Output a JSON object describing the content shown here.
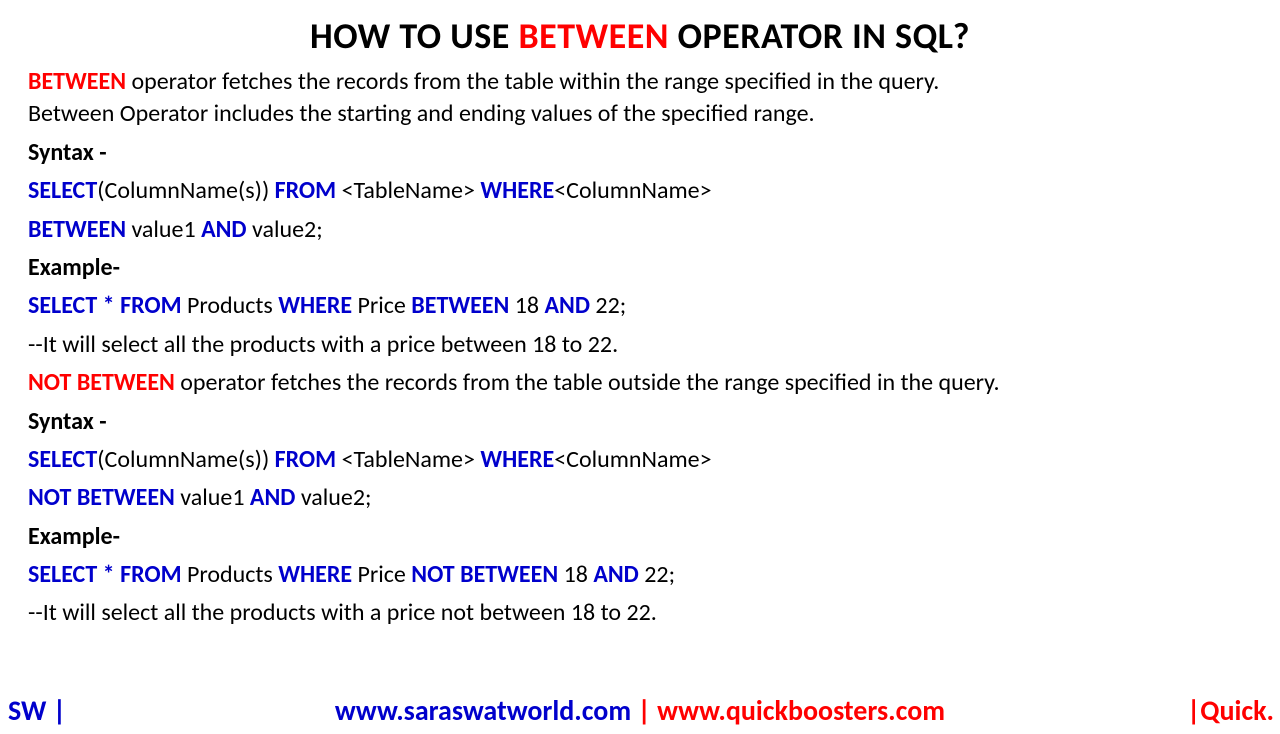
{
  "title": {
    "pre": "HOW TO USE ",
    "highlight": "BETWEEN",
    "post": " OPERATOR IN SQL?"
  },
  "intro": {
    "lead": "BETWEEN",
    "rest1": " operator fetches the records from the table within the range specified in the query.",
    "rest2": "Between Operator includes the starting and ending values of the specified range."
  },
  "syntax_label": "Syntax -",
  "syntax1": {
    "select": "SELECT",
    "col": "(ColumnName(s)) ",
    "from": "FROM",
    "tbl": " <TableName> ",
    "where": "WHERE",
    "colname": "<ColumnName>",
    "between": "BETWEEN",
    "v1": " value1 ",
    "and": "AND",
    "v2": " value2;"
  },
  "example_label": "Example-",
  "ex1": {
    "p1": "SELECT * FROM",
    "p2": " Products ",
    "p3": "WHERE",
    "p4": " Price ",
    "p5": "BETWEEN",
    "p6": " 18 ",
    "p7": "AND",
    "p8": " 22;"
  },
  "ex1_comment": "--It will select all the products with a price between 18 to 22.",
  "not_intro": {
    "lead": "NOT BETWEEN",
    "rest": " operator fetches the records from the table outside the range specified in the query."
  },
  "syntax2": {
    "select": "SELECT",
    "col": "(ColumnName(s)) ",
    "from": "FROM",
    "tbl": " <TableName> ",
    "where": "WHERE",
    "colname": "<ColumnName>",
    "notbetween": "NOT BETWEEN",
    "v1": " value1 ",
    "and": "AND",
    "v2": " value2;"
  },
  "ex2": {
    "p1": "SELECT * FROM",
    "p2": " Products ",
    "p3": "WHERE",
    "p4": " Price ",
    "p5": "NOT BETWEEN",
    "p6": " 18 ",
    "p7": "AND",
    "p8": " 22;"
  },
  "ex2_comment": "--It will select all the products with a price not between 18 to 22.",
  "footer": {
    "left": "SW |",
    "center_blue": "www.saraswatworld.com",
    "center_sep": " | ",
    "center_red": "www.quickboosters.com",
    "right": "|Quick."
  }
}
